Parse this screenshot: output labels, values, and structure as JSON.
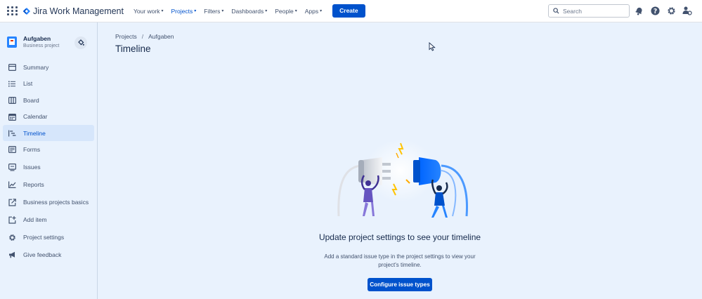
{
  "topnav": {
    "app_name": "Jira Work Management",
    "items": [
      {
        "label": "Your work"
      },
      {
        "label": "Projects"
      },
      {
        "label": "Filters"
      },
      {
        "label": "Dashboards"
      },
      {
        "label": "People"
      },
      {
        "label": "Apps"
      }
    ],
    "active_item": "Projects",
    "create_label": "Create",
    "search_placeholder": "Search",
    "icons": [
      "notifications-icon",
      "help-icon",
      "settings-icon",
      "profile-icon"
    ],
    "accent_color": "#0052CC"
  },
  "sidebar": {
    "project_name": "Aufgaben",
    "project_type": "Business project",
    "items": [
      {
        "label": "Summary",
        "icon": "summary-icon"
      },
      {
        "label": "List",
        "icon": "list-icon"
      },
      {
        "label": "Board",
        "icon": "board-icon"
      },
      {
        "label": "Calendar",
        "icon": "calendar-icon"
      },
      {
        "label": "Timeline",
        "icon": "timeline-icon"
      },
      {
        "label": "Forms",
        "icon": "forms-icon"
      },
      {
        "label": "Issues",
        "icon": "issues-icon"
      },
      {
        "label": "Reports",
        "icon": "reports-icon"
      },
      {
        "label": "Business projects basics",
        "icon": "external-link-icon"
      },
      {
        "label": "Add item",
        "icon": "add-item-icon"
      },
      {
        "label": "Project settings",
        "icon": "gear-icon"
      },
      {
        "label": "Give feedback",
        "icon": "megaphone-icon"
      }
    ],
    "active_item": "Timeline"
  },
  "main": {
    "breadcrumb": [
      "Projects",
      "Aufgaben"
    ],
    "title": "Timeline",
    "empty_state": {
      "title": "Update project settings to see your timeline",
      "description": "Add a standard issue type in the project settings to view your project's timeline.",
      "button_label": "Configure issue types"
    }
  }
}
